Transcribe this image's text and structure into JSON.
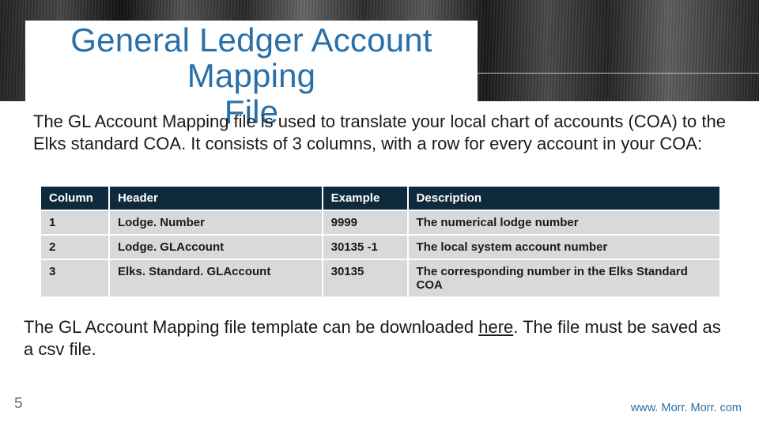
{
  "title_line1": "General Ledger Account Mapping",
  "title_line2": "File",
  "intro": "The GL Account Mapping file is used to translate your local chart of accounts (COA) to the Elks standard COA.  It consists of 3 columns, with a row for every account in your COA:",
  "table": {
    "headers": {
      "c1": "Column",
      "c2": "Header",
      "c3": "Example",
      "c4": "Description"
    },
    "rows": [
      {
        "c1": "1",
        "c2": "Lodge. Number",
        "c3": "9999",
        "c4": "The numerical lodge number"
      },
      {
        "c1": "2",
        "c2": "Lodge. GLAccount",
        "c3": "30135 -1",
        "c4": "The local system account number"
      },
      {
        "c1": "3",
        "c2": "Elks. Standard. GLAccount",
        "c3": "30135",
        "c4": "The corresponding number in the Elks Standard COA"
      }
    ]
  },
  "outro_pre": "The GL Account Mapping file template can be downloaded ",
  "outro_link": "here",
  "outro_post": ".  The file must be saved as a csv file.",
  "page_number": "5",
  "footer_url": "www. Morr. Morr. com"
}
